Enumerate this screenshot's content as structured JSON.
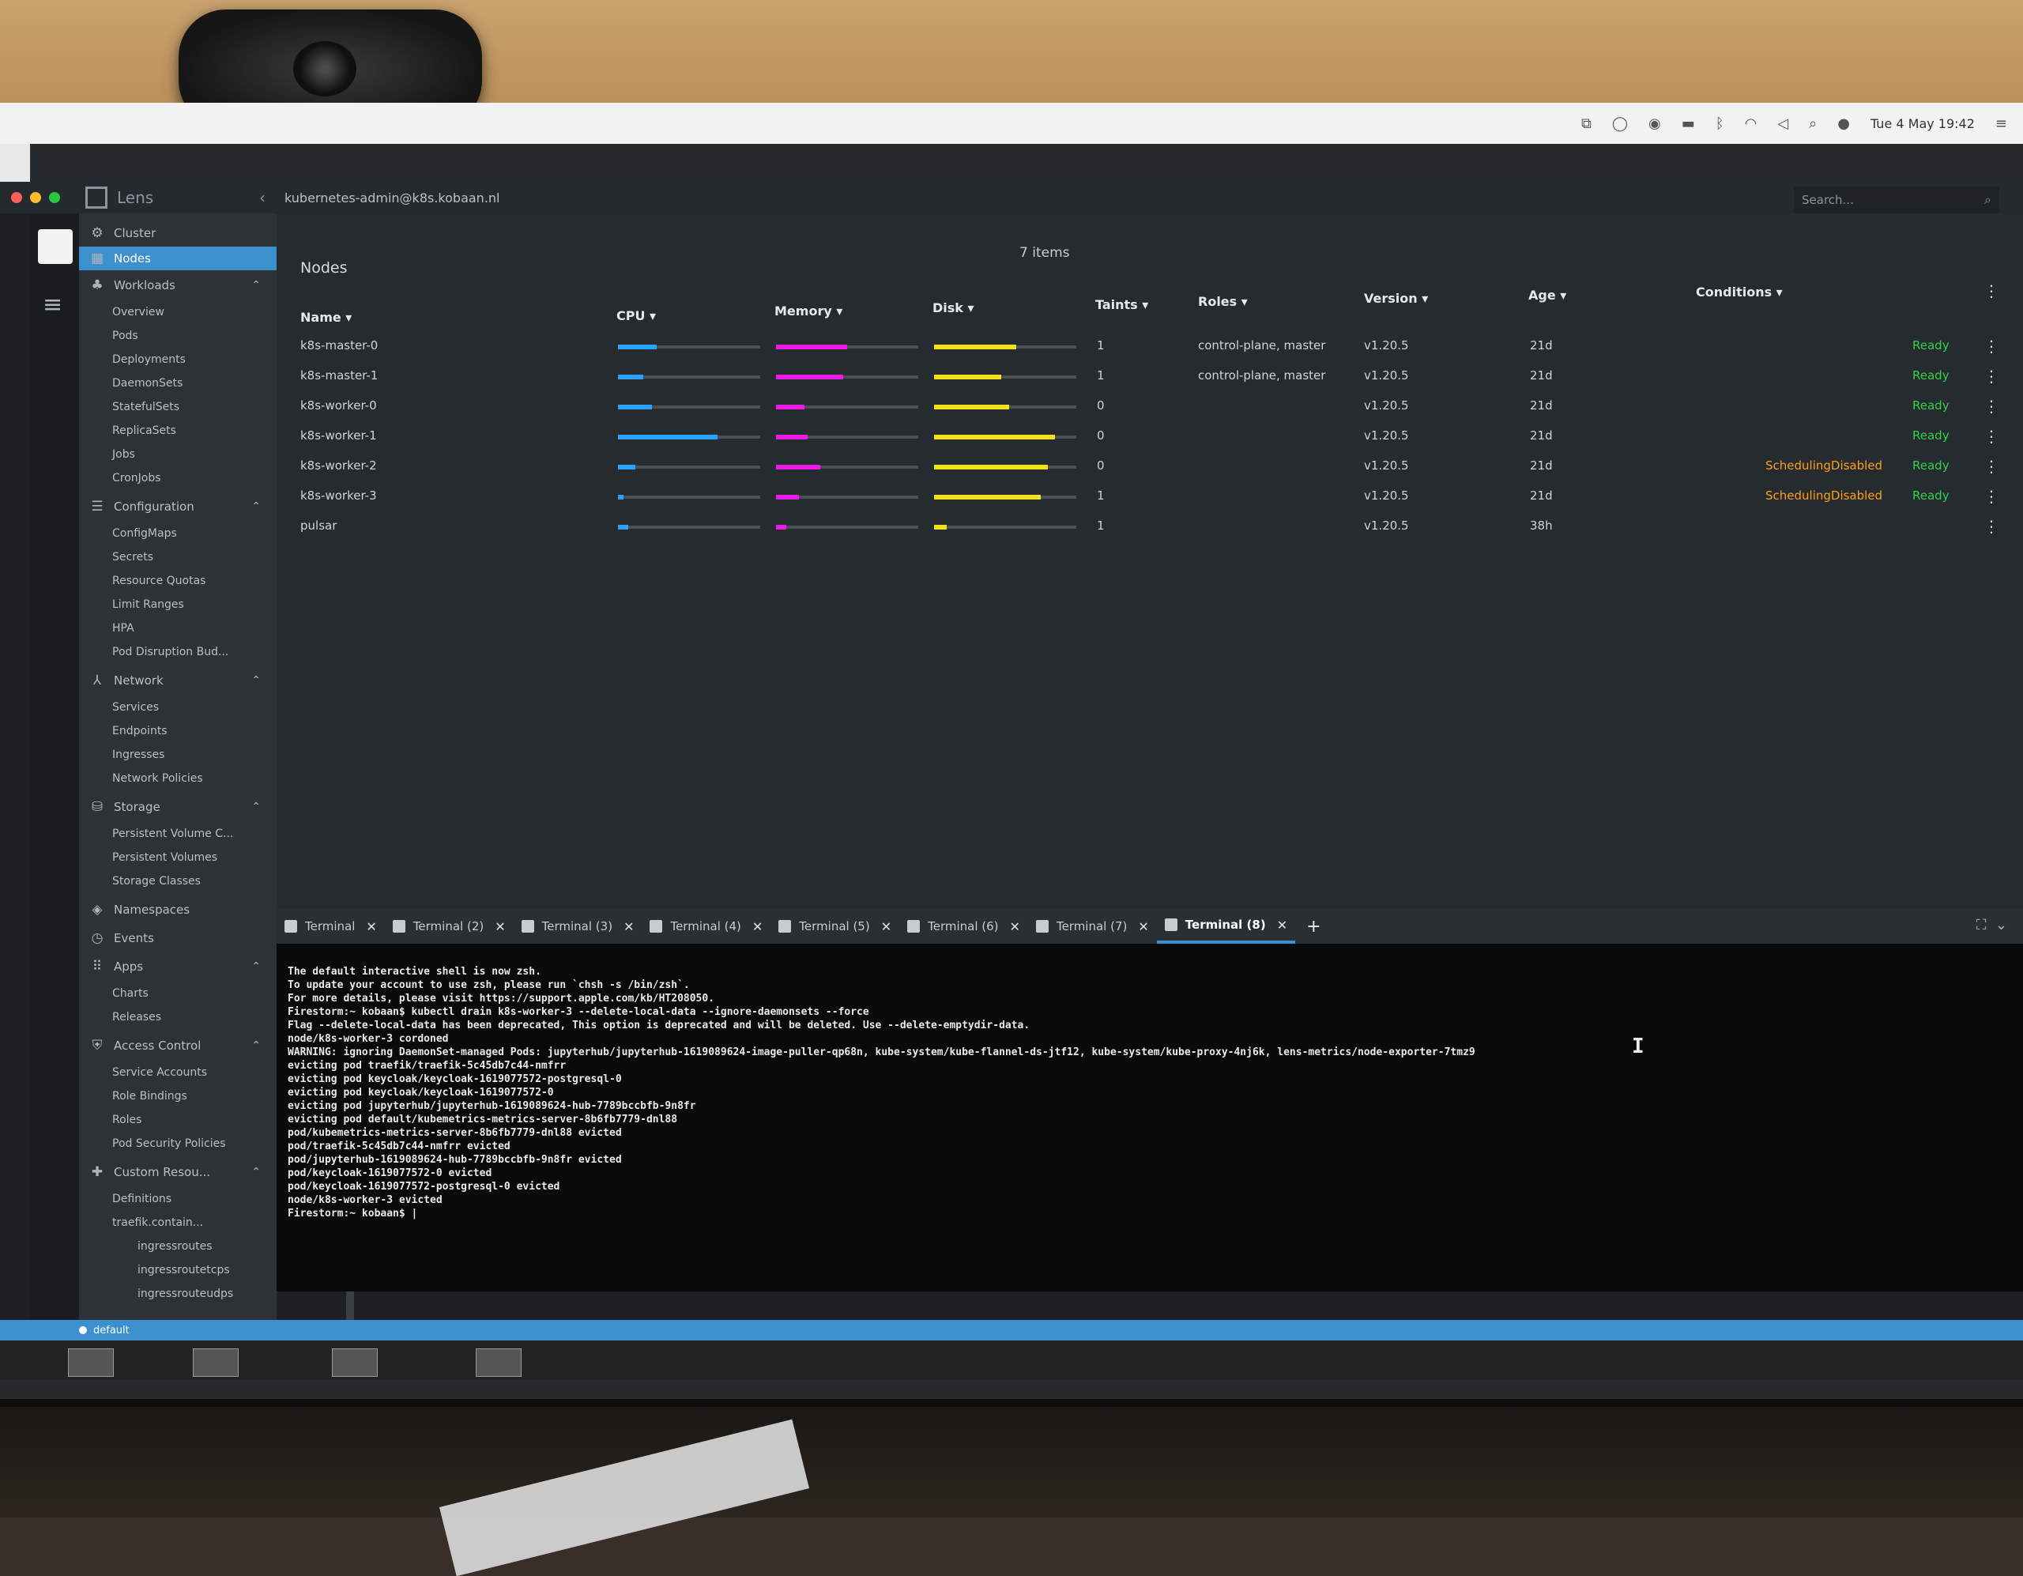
{
  "app": {
    "name": "Lens",
    "context": "kubernetes-admin@k8s.kobaan.nl"
  },
  "menubar": {
    "clock": "Tue 4 May 19:42"
  },
  "search": {
    "placeholder": "Search..."
  },
  "sidebar": {
    "cluster": "Cluster",
    "nodes": "Nodes",
    "workloads": {
      "label": "Workloads",
      "items": [
        "Overview",
        "Pods",
        "Deployments",
        "DaemonSets",
        "StatefulSets",
        "ReplicaSets",
        "Jobs",
        "CronJobs"
      ]
    },
    "configuration": {
      "label": "Configuration",
      "items": [
        "ConfigMaps",
        "Secrets",
        "Resource Quotas",
        "Limit Ranges",
        "HPA",
        "Pod Disruption Bud..."
      ]
    },
    "network": {
      "label": "Network",
      "items": [
        "Services",
        "Endpoints",
        "Ingresses",
        "Network Policies"
      ]
    },
    "storage": {
      "label": "Storage",
      "items": [
        "Persistent Volume C...",
        "Persistent Volumes",
        "Storage Classes"
      ]
    },
    "namespaces": "Namespaces",
    "events": "Events",
    "apps": {
      "label": "Apps",
      "items": [
        "Charts",
        "Releases"
      ]
    },
    "access": {
      "label": "Access Control",
      "items": [
        "Service Accounts",
        "Role Bindings",
        "Roles",
        "Pod Security Policies"
      ]
    },
    "custom": {
      "label": "Custom Resou...",
      "items": [
        "Definitions"
      ],
      "group": "traefik.contain...",
      "group_items": [
        "ingressroutes",
        "ingressroutetcps",
        "ingressrouteudps"
      ]
    }
  },
  "nodes": {
    "title": "Nodes",
    "count": "7 items",
    "columns": {
      "name": "Name",
      "cpu": "CPU",
      "memory": "Memory",
      "disk": "Disk",
      "taints": "Taints",
      "roles": "Roles",
      "version": "Version",
      "age": "Age",
      "conditions": "Conditions"
    },
    "rows": [
      {
        "name": "k8s-master-0",
        "cpu": 0.27,
        "memory": 0.5,
        "disk": 0.58,
        "taints": "1",
        "roles": "control-plane, master",
        "version": "v1.20.5",
        "age": "21d",
        "scheduling": "",
        "ready": "Ready"
      },
      {
        "name": "k8s-master-1",
        "cpu": 0.18,
        "memory": 0.47,
        "disk": 0.47,
        "taints": "1",
        "roles": "control-plane, master",
        "version": "v1.20.5",
        "age": "21d",
        "scheduling": "",
        "ready": "Ready"
      },
      {
        "name": "k8s-worker-0",
        "cpu": 0.24,
        "memory": 0.2,
        "disk": 0.53,
        "taints": "0",
        "roles": "",
        "version": "v1.20.5",
        "age": "21d",
        "scheduling": "",
        "ready": "Ready"
      },
      {
        "name": "k8s-worker-1",
        "cpu": 0.7,
        "memory": 0.22,
        "disk": 0.85,
        "taints": "0",
        "roles": "",
        "version": "v1.20.5",
        "age": "21d",
        "scheduling": "",
        "ready": "Ready"
      },
      {
        "name": "k8s-worker-2",
        "cpu": 0.12,
        "memory": 0.31,
        "disk": 0.8,
        "taints": "0",
        "roles": "",
        "version": "v1.20.5",
        "age": "21d",
        "scheduling": "SchedulingDisabled",
        "ready": "Ready"
      },
      {
        "name": "k8s-worker-3",
        "cpu": 0.04,
        "memory": 0.16,
        "disk": 0.75,
        "taints": "1",
        "roles": "",
        "version": "v1.20.5",
        "age": "21d",
        "scheduling": "SchedulingDisabled",
        "ready": "Ready"
      },
      {
        "name": "pulsar",
        "cpu": 0.07,
        "memory": 0.07,
        "disk": 0.09,
        "taints": "1",
        "roles": "",
        "version": "v1.20.5",
        "age": "38h",
        "scheduling": "",
        "ready": ""
      }
    ]
  },
  "terminal": {
    "tabs": [
      "Terminal",
      "Terminal (2)",
      "Terminal (3)",
      "Terminal (4)",
      "Terminal (5)",
      "Terminal (6)",
      "Terminal (7)",
      "Terminal (8)"
    ],
    "active_tab": 7,
    "lines": [
      "The default interactive shell is now zsh.",
      "To update your account to use zsh, please run `chsh -s /bin/zsh`.",
      "For more details, please visit https://support.apple.com/kb/HT208050.",
      "Firestorm:~ kobaan$ kubectl drain k8s-worker-3 --delete-local-data --ignore-daemonsets --force",
      "Flag --delete-local-data has been deprecated, This option is deprecated and will be deleted. Use --delete-emptydir-data.",
      "node/k8s-worker-3 cordoned",
      "WARNING: ignoring DaemonSet-managed Pods: jupyterhub/jupyterhub-1619089624-image-puller-qp68n, kube-system/kube-flannel-ds-jtf12, kube-system/kube-proxy-4nj6k, lens-metrics/node-exporter-7tmz9",
      "evicting pod traefik/traefik-5c45db7c44-nmfrr",
      "evicting pod keycloak/keycloak-1619077572-postgresql-0",
      "evicting pod keycloak/keycloak-1619077572-0",
      "evicting pod jupyterhub/jupyterhub-1619089624-hub-7789bccbfb-9n8fr",
      "evicting pod default/kubemetrics-metrics-server-8b6fb7779-dnl88",
      "pod/kubemetrics-metrics-server-8b6fb7779-dnl88 evicted",
      "pod/traefik-5c45db7c44-nmfrr evicted",
      "pod/jupyterhub-1619089624-hub-7789bccbfb-9n8fr evicted",
      "pod/keycloak-1619077572-0 evicted",
      "pod/keycloak-1619077572-postgresql-0 evicted",
      "node/k8s-worker-3 evicted",
      "Firestorm:~ kobaan$ |"
    ]
  },
  "statusbar": {
    "namespace": "default"
  },
  "colors": {
    "accent": "#3d90ce",
    "cpu": "#2aa3ff",
    "memory": "#e81ce6",
    "disk": "#f2e21c",
    "ready": "#2fd34a",
    "scheduling": "#ff9f1a"
  }
}
